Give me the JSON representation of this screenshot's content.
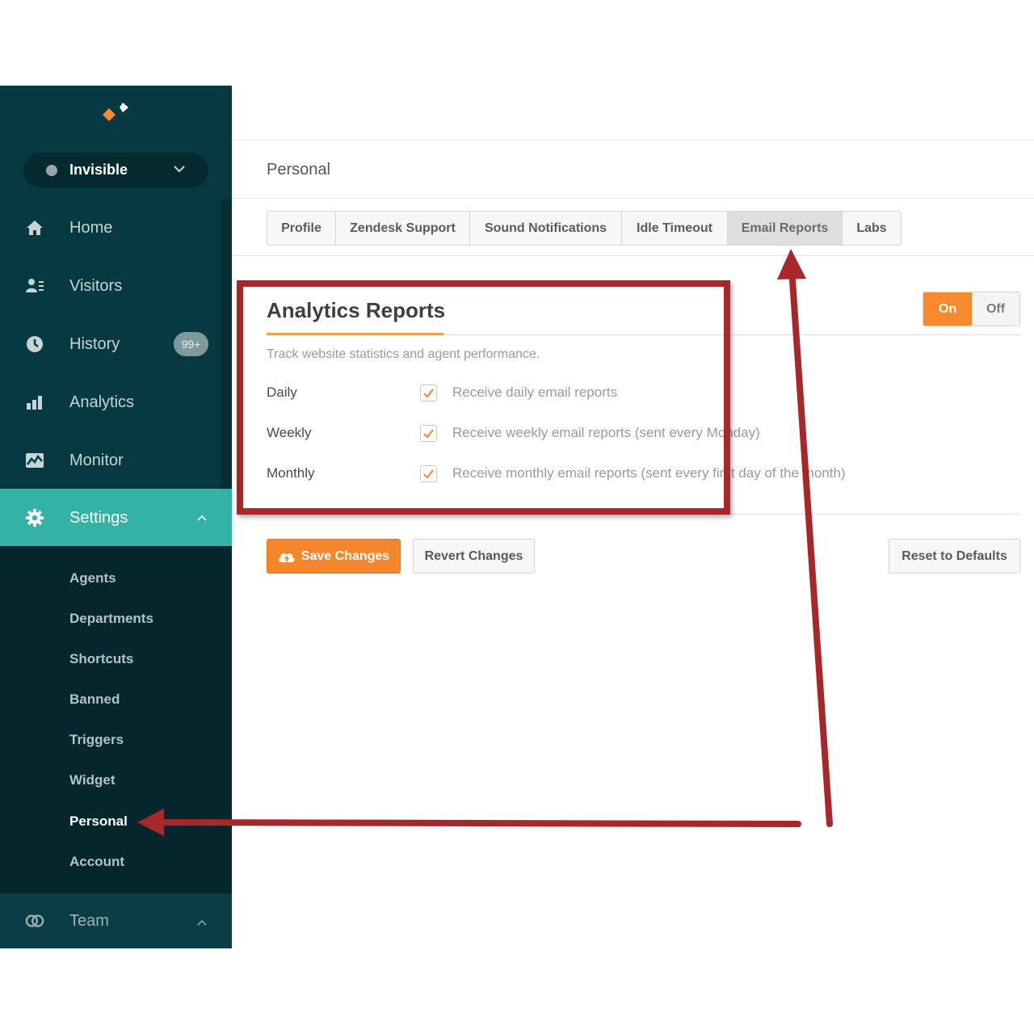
{
  "sidebar": {
    "status": {
      "label": "Invisible"
    },
    "nav": [
      {
        "label": "Home",
        "icon": "home-icon"
      },
      {
        "label": "Visitors",
        "icon": "visitors-icon"
      },
      {
        "label": "History",
        "icon": "clock-icon",
        "badge": "99+"
      },
      {
        "label": "Analytics",
        "icon": "bar-chart-icon"
      },
      {
        "label": "Monitor",
        "icon": "monitor-icon"
      },
      {
        "label": "Settings",
        "icon": "gear-icon"
      }
    ],
    "settings_sub": [
      "Agents",
      "Departments",
      "Shortcuts",
      "Banned",
      "Triggers",
      "Widget",
      "Personal",
      "Account"
    ],
    "team": {
      "label": "Team",
      "icon": "team-icon"
    }
  },
  "main": {
    "page_title": "Personal",
    "tabs": [
      "Profile",
      "Zendesk Support",
      "Sound Notifications",
      "Idle Timeout",
      "Email Reports",
      "Labs"
    ],
    "selected_tab": "Email Reports",
    "section": {
      "title": "Analytics Reports",
      "description": "Track website statistics and agent performance.",
      "toggle": {
        "on_label": "On",
        "off_label": "Off",
        "value": "On"
      },
      "rows": [
        {
          "label": "Daily",
          "text": "Receive daily email reports",
          "checked": true
        },
        {
          "label": "Weekly",
          "text": "Receive weekly email reports (sent every Monday)",
          "checked": true
        },
        {
          "label": "Monthly",
          "text": "Receive monthly email reports (sent every first day of the month)",
          "checked": true
        }
      ]
    },
    "buttons": {
      "save": "Save Changes",
      "revert": "Revert Changes",
      "reset": "Reset to Defaults"
    }
  },
  "colors": {
    "sidebar_bg": "#063a40",
    "active_teal": "#33b2a8",
    "accent_orange": "#f68a2d",
    "annotation_red": "#a8272a"
  }
}
